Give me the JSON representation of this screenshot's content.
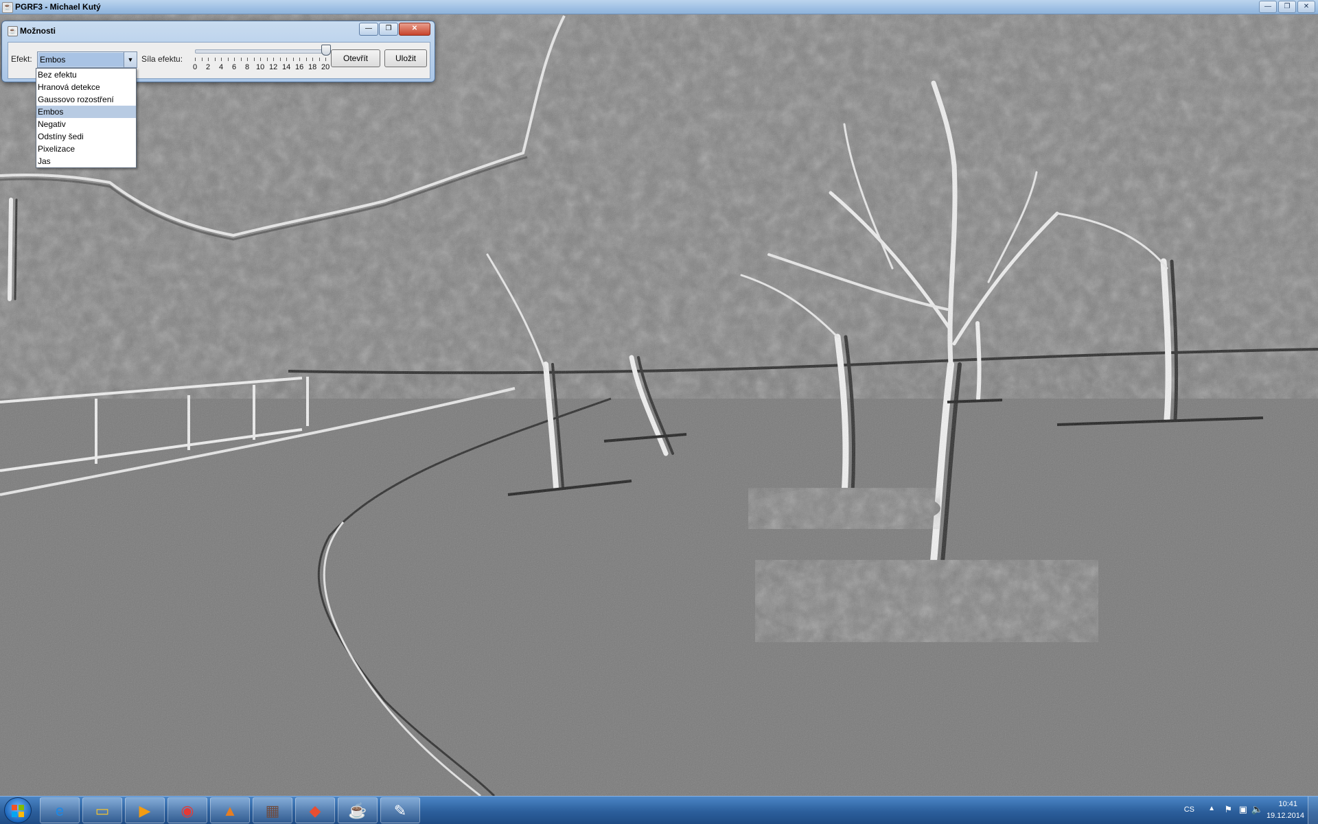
{
  "main_window": {
    "title": "PGRF3 - Michael Kutý",
    "controls": [
      "—",
      "❐",
      "✕"
    ]
  },
  "dialog": {
    "title": "Možnosti",
    "controls": [
      "—",
      "❐",
      "✕"
    ],
    "effect_label": "Efekt:",
    "effect_selected": "Embos",
    "strength_label": "Síla efektu:",
    "slider": {
      "min": 0,
      "max": 20,
      "value": 20,
      "tick_labels": [
        "0",
        "2",
        "4",
        "6",
        "8",
        "10",
        "12",
        "14",
        "16",
        "18",
        "20"
      ]
    },
    "open_button": "Otevřít",
    "save_button": "Uložit"
  },
  "dropdown": {
    "options": [
      "Bez efektu",
      "Hranová detekce",
      "Gaussovo rozostření",
      "Embos",
      "Negativ",
      "Odstíny šedi",
      "Pixelizace",
      "Jas"
    ],
    "selected_index": 3
  },
  "taskbar": {
    "items": [
      {
        "name": "internet-explorer-icon",
        "glyph": "e",
        "color": "#1e88e5"
      },
      {
        "name": "file-explorer-icon",
        "glyph": "▭",
        "color": "#f1c232"
      },
      {
        "name": "media-player-icon",
        "glyph": "▶",
        "color": "#f39c12"
      },
      {
        "name": "chrome-icon",
        "glyph": "◉",
        "color": "#e53935"
      },
      {
        "name": "matlab-icon",
        "glyph": "▲",
        "color": "#e67e22"
      },
      {
        "name": "java-ee-icon",
        "glyph": "▦",
        "color": "#6d4c41"
      },
      {
        "name": "git-icon",
        "glyph": "◆",
        "color": "#e84e31"
      },
      {
        "name": "java-icon",
        "glyph": "☕",
        "color": "#ffffff"
      },
      {
        "name": "paint-icon",
        "glyph": "✎",
        "color": "#ffffff"
      }
    ],
    "language": "CS",
    "time": "10:41",
    "date": "19.12.2014"
  },
  "colors": {
    "image_gray": "#7b7b7b",
    "taskbar_blue": "#2c5f9c",
    "selection": "#b8cbe3"
  }
}
